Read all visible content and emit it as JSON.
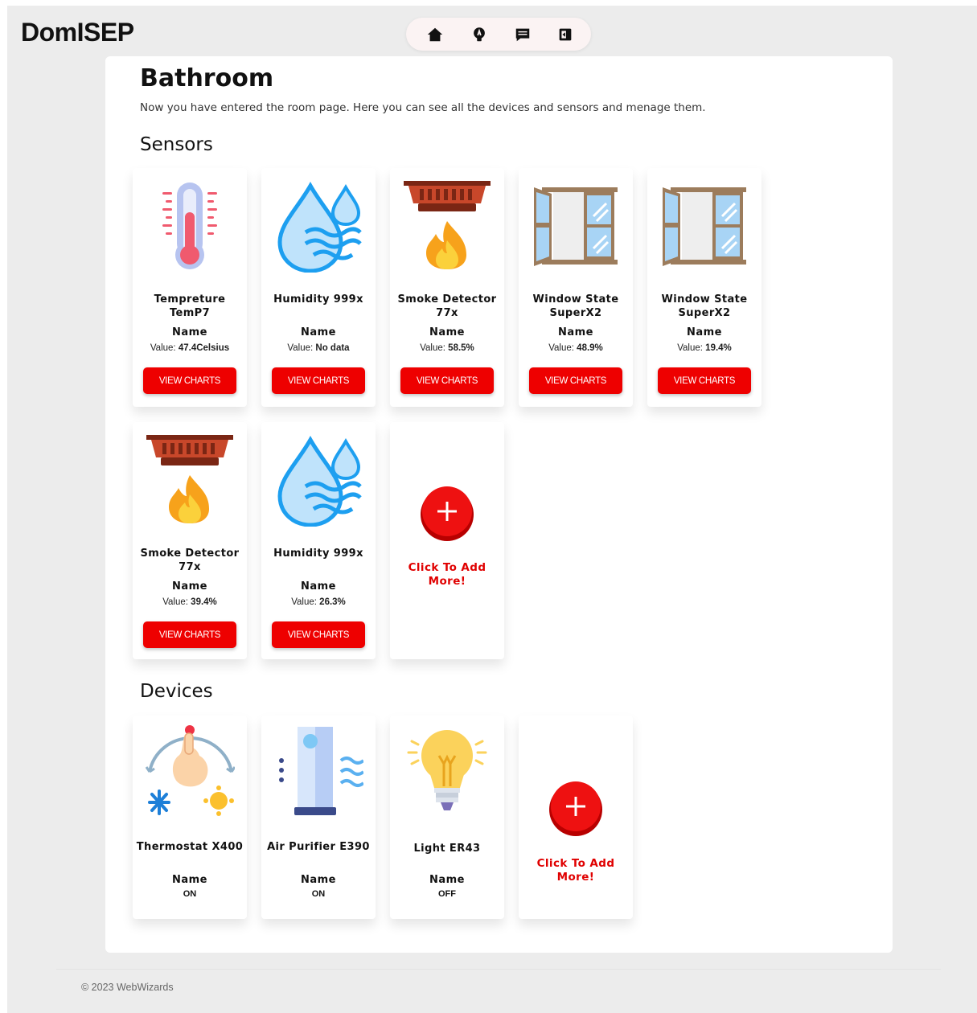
{
  "header": {
    "logo": "DomISEP",
    "nav": [
      {
        "icon": "home-icon"
      },
      {
        "icon": "lightbulb-icon"
      },
      {
        "icon": "message-icon"
      },
      {
        "icon": "logout-icon"
      }
    ]
  },
  "room": {
    "title": "Bathroom",
    "description": "Now you have entered the room page. Here you can see all the devices and sensors and menage them."
  },
  "sensors": {
    "title": "Sensors",
    "items": [
      {
        "title": "Tempreture TemP7",
        "name": "Name",
        "value_label": "Value:",
        "value": "47.4Celsius",
        "button": "VIEW CHARTS",
        "icon": "thermometer-icon"
      },
      {
        "title": "Humidity 999x",
        "name": "Name",
        "value_label": "Value:",
        "value": "No data",
        "button": "VIEW CHARTS",
        "icon": "humidity-icon"
      },
      {
        "title": "Smoke Detector 77x",
        "name": "Name",
        "value_label": "Value:",
        "value": "58.5%",
        "button": "VIEW CHARTS",
        "icon": "smoke-detector-icon"
      },
      {
        "title": "Window State SuperX2",
        "name": "Name",
        "value_label": "Value:",
        "value": "48.9%",
        "button": "VIEW CHARTS",
        "icon": "window-icon"
      },
      {
        "title": "Window State SuperX2",
        "name": "Name",
        "value_label": "Value:",
        "value": "19.4%",
        "button": "VIEW CHARTS",
        "icon": "window-icon"
      },
      {
        "title": "Smoke Detector 77x",
        "name": "Name",
        "value_label": "Value:",
        "value": "39.4%",
        "button": "VIEW CHARTS",
        "icon": "smoke-detector-icon"
      },
      {
        "title": "Humidity 999x",
        "name": "Name",
        "value_label": "Value:",
        "value": "26.3%",
        "button": "VIEW CHARTS",
        "icon": "humidity-icon"
      }
    ],
    "add_label": "Click To Add More!"
  },
  "devices": {
    "title": "Devices",
    "items": [
      {
        "title": "Thermostat X400",
        "name": "Name",
        "state": "ON",
        "icon": "thermostat-icon"
      },
      {
        "title": "Air Purifier E390",
        "name": "Name",
        "state": "ON",
        "icon": "air-purifier-icon"
      },
      {
        "title": "Light ER43",
        "name": "Name",
        "state": "OFF",
        "icon": "light-bulb-icon"
      }
    ],
    "add_label": "Click To Add More!"
  },
  "footer": {
    "copyright": "© 2023 WebWizards"
  },
  "colors": {
    "accent": "#ee0000",
    "background": "#ececec",
    "card": "#ffffff"
  }
}
